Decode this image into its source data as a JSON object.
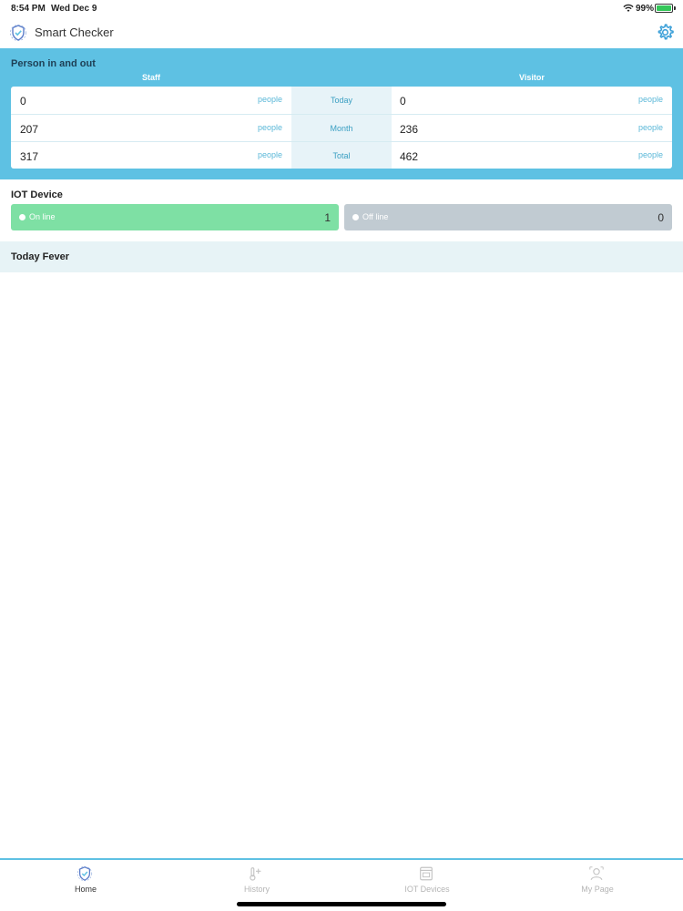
{
  "status_bar": {
    "time": "8:54 PM",
    "date": "Wed Dec 9",
    "battery": "99%",
    "battery_level": 0.99
  },
  "header": {
    "title": "Smart Checker",
    "logo_icon": "shield-check-icon",
    "settings_icon": "gear-icon"
  },
  "person": {
    "title": "Person in and out",
    "staff_label": "Staff",
    "visitor_label": "Visitor",
    "unit": "people",
    "rows": [
      {
        "period": "Today",
        "staff": "0",
        "visitor": "0"
      },
      {
        "period": "Month",
        "staff": "207",
        "visitor": "236"
      },
      {
        "period": "Total",
        "staff": "317",
        "visitor": "462"
      }
    ]
  },
  "iot": {
    "title": "IOT Device",
    "online_label": "On line",
    "online_count": "1",
    "offline_label": "Off line",
    "offline_count": "0"
  },
  "fever": {
    "title": "Today Fever"
  },
  "tabs": [
    {
      "label": "Home",
      "icon": "home-shield-icon",
      "active": true
    },
    {
      "label": "History",
      "icon": "thermometer-icon",
      "active": false
    },
    {
      "label": "IOT Devices",
      "icon": "device-icon",
      "active": false
    },
    {
      "label": "My Page",
      "icon": "user-icon",
      "active": false
    }
  ],
  "colors": {
    "accent": "#5ec1e3",
    "online": "#7ee0a4",
    "offline": "#c1cbd2"
  }
}
